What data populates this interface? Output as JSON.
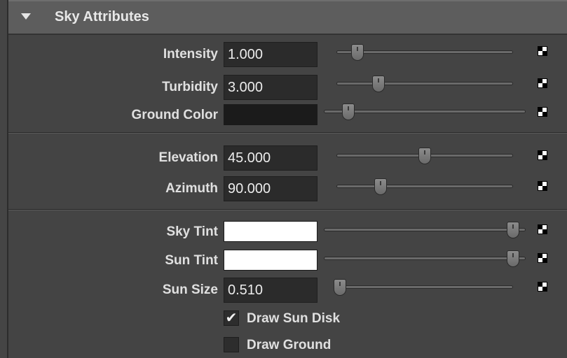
{
  "section": {
    "title": "Sky Attributes",
    "icon": "collapse-arrow-icon"
  },
  "rows": {
    "intensity": {
      "label": "Intensity",
      "value": "1.000",
      "slider_fraction": 0.12
    },
    "turbidity": {
      "label": "Turbidity",
      "value": "3.000",
      "slider_fraction": 0.24
    },
    "ground_color": {
      "label": "Ground Color",
      "color": "#1b1b1b",
      "slider_fraction": 0.12
    },
    "elevation": {
      "label": "Elevation",
      "value": "45.000",
      "slider_fraction": 0.5
    },
    "azimuth": {
      "label": "Azimuth",
      "value": "90.000",
      "slider_fraction": 0.25
    },
    "sky_tint": {
      "label": "Sky Tint",
      "color": "#ffffff",
      "slider_fraction": 1.0
    },
    "sun_tint": {
      "label": "Sun Tint",
      "color": "#ffffff",
      "slider_fraction": 1.0
    },
    "sun_size": {
      "label": "Sun Size",
      "value": "0.510",
      "slider_fraction": 0.02
    }
  },
  "checkboxes": {
    "draw_sun_disk": {
      "label": "Draw Sun Disk",
      "checked": true
    },
    "draw_ground": {
      "label": "Draw Ground",
      "checked": false
    }
  },
  "colors": {
    "panel_bg": "#444444",
    "header_bg": "#5d5d5d",
    "field_bg": "#2b2b2b"
  }
}
